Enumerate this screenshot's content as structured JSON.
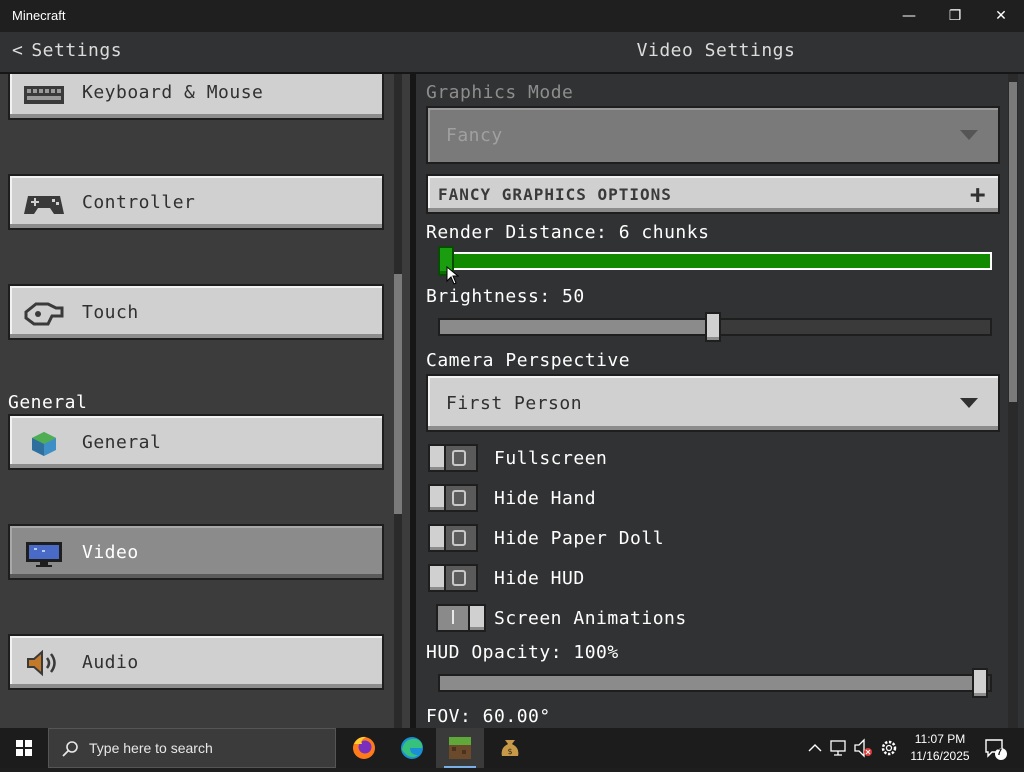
{
  "window": {
    "title": "Minecraft",
    "controls": {
      "minimize": "—",
      "restore": "❐",
      "close": "✕"
    }
  },
  "header": {
    "back_label": "Settings",
    "page_title": "Video Settings"
  },
  "sidebar": {
    "items": [
      {
        "label": "Keyboard & Mouse",
        "icon": "keyboard-icon"
      },
      {
        "label": "Controller",
        "icon": "gamepad-icon"
      },
      {
        "label": "Touch",
        "icon": "touch-hand-icon"
      },
      {
        "label": "General",
        "icon": "globe-block-icon"
      },
      {
        "label": "Video",
        "icon": "monitor-icon",
        "selected": true
      },
      {
        "label": "Audio",
        "icon": "speaker-icon"
      }
    ],
    "section_general": "General"
  },
  "video": {
    "graphics_mode": {
      "label": "Graphics Mode",
      "value": "Fancy",
      "disabled": true
    },
    "fancy_options": {
      "label": "FANCY GRAPHICS OPTIONS",
      "expand_icon": "plus-icon"
    },
    "render_distance": {
      "label": "Render Distance: 6 chunks",
      "fraction": 0.0,
      "color": "#128a00"
    },
    "brightness": {
      "label": "Brightness: 50",
      "fraction": 0.5
    },
    "camera": {
      "label": "Camera Perspective",
      "value": "First Person"
    },
    "toggles": [
      {
        "label": "Fullscreen",
        "on": false
      },
      {
        "label": "Hide Hand",
        "on": false
      },
      {
        "label": "Hide Paper Doll",
        "on": false
      },
      {
        "label": "Hide HUD",
        "on": false
      },
      {
        "label": "Screen Animations",
        "on": true
      }
    ],
    "hud_opacity": {
      "label": "HUD Opacity: 100%",
      "fraction": 1.0
    },
    "fov": {
      "label": "FOV: 60.00°"
    }
  },
  "taskbar": {
    "search_placeholder": "Type here to search",
    "apps": [
      "firefox-icon",
      "edge-icon",
      "minecraft-icon",
      "money-bag-icon"
    ],
    "time": "11:07 PM",
    "date": "11/16/2025",
    "notification_count": "7"
  }
}
